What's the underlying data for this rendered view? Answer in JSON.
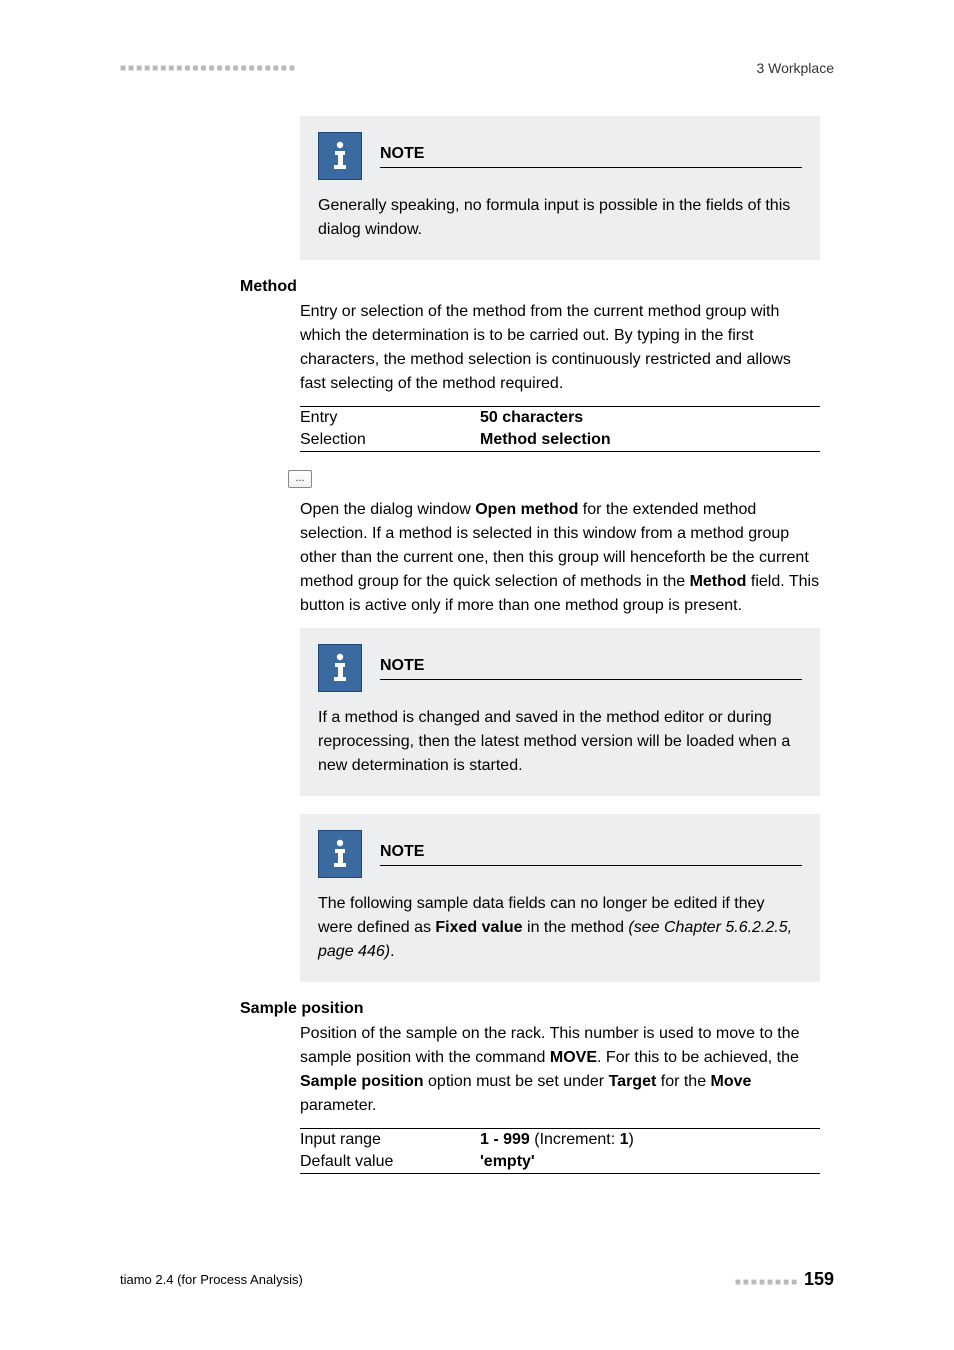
{
  "header": {
    "breadcrumb": "3 Workplace"
  },
  "note1": {
    "title": "NOTE",
    "body": "Generally speaking, no formula input is possible in the fields of this dialog window."
  },
  "method": {
    "heading": "Method",
    "para": "Entry or selection of the method from the current method group with which the determination is to be carried out. By typing in the first characters, the method selection is continuously restricted and allows fast selecting of the method required.",
    "row1_label": "Entry",
    "row1_value": "50 characters",
    "row2_label": "Selection",
    "row2_value": "Method selection"
  },
  "openMethod": {
    "p_a": "Open the dialog window ",
    "p_b": "Open method",
    "p_c": " for the extended method selection. If a method is selected in this window from a method group other than the current one, then this group will henceforth be the current method group for the quick selection of methods in the ",
    "p_d": "Method",
    "p_e": " field. This button is active only if more than one method group is present."
  },
  "note2": {
    "title": "NOTE",
    "body": "If a method is changed and saved in the method editor or during reprocessing, then the latest method version will be loaded when a new determination is started."
  },
  "note3": {
    "title": "NOTE",
    "p_a": "The following sample data fields can no longer be edited if they were defined as ",
    "p_b": "Fixed value",
    "p_c": " in the method ",
    "p_d": "(see Chapter 5.6.2.2.5, page 446)",
    "p_e": "."
  },
  "sample": {
    "heading": "Sample position",
    "p_a": "Position of the sample on the rack. This number is used to move to the sample position with the command ",
    "p_b": "MOVE",
    "p_c": ". For this to be achieved, the ",
    "p_d": "Sample position",
    "p_e": " option must be set under ",
    "p_f": "Target",
    "p_g": " for the ",
    "p_h": "Move",
    "p_i": " parameter.",
    "row1_label": "Input range",
    "row1_v1": "1 - 999",
    "row1_v2": "  (Increment: ",
    "row1_v3": "1",
    "row1_v4": ")",
    "row2_label": "Default value",
    "row2_value": "'empty'"
  },
  "footer": {
    "left": "tiamo 2.4 (for Process Analysis)",
    "page": "159"
  }
}
